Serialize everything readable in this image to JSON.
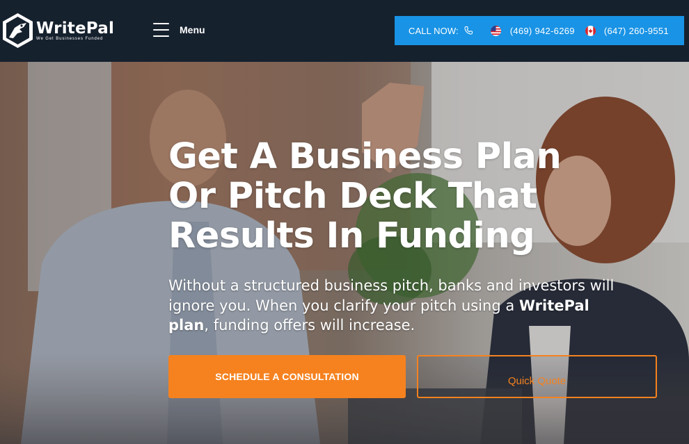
{
  "header": {
    "logo_name": "WritePal",
    "logo_tagline": "We Get Businesses Funded",
    "menu_label": "Menu",
    "call": {
      "label": "CALL NOW:",
      "us_number": "(469) 942-6269",
      "ca_number": "(647) 260-9551"
    }
  },
  "hero": {
    "headline_line1": "Get A Business Plan",
    "headline_line2": "Or Pitch Deck That",
    "headline_line3": "Results In Funding",
    "sub_before": "Without a structured business pitch, banks and investors will ignore you. When you clarify your pitch using a ",
    "sub_bold": "WritePal plan",
    "sub_after": ", funding offers will increase.",
    "primary_cta": "SCHEDULE A CONSULTATION",
    "secondary_cta": "Quick Quote"
  },
  "colors": {
    "header_bg": "#16212e",
    "call_bg": "#1993e5",
    "accent_orange": "#f5821f"
  },
  "icons": [
    "writepal-logo-icon",
    "hamburger-menu-icon",
    "phone-icon",
    "us-flag-icon",
    "canada-flag-icon"
  ]
}
